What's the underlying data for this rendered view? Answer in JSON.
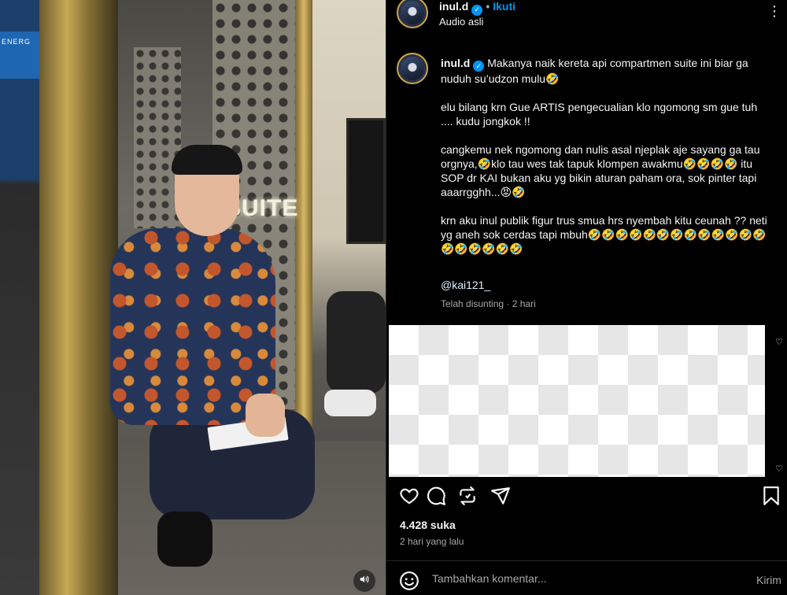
{
  "post": {
    "username": "inul.d",
    "separator": "•",
    "follow_label": "Ikuti",
    "audio_label": "Audio asli",
    "more_label": "⋮"
  },
  "caption": {
    "username": "inul.d",
    "paragraphs": [
      "Makanya naik kereta api compartmen suite ini biar ga nuduh su’udzon mulu🤣",
      "elu bilang krn Gue ARTIS pengecualian klo ngomong sm gue tuh .... kudu jongkok !!",
      "cangkemu nek ngomong dan nulis asal njeplak aje sayang ga tau orgnya,🤣klo tau wes tak tapuk klompen awakmu🤣🤣🤣🤣 itu SOP dr KAI bukan aku yg bikin aturan paham ora, sok pinter tapi aaarrgghh...😡🤣",
      "krn aku inul publik figur trus smua hrs nyembah kitu ceunah ?? neti yg aneh sok cerdas tapi mbuh🤣🤣🤣🤣🤣🤣🤣🤣🤣🤣🤣🤣🤣🤣🤣🤣🤣🤣🤣"
    ],
    "mention": "@kai121_",
    "meta": "Telah disunting · 2 hari"
  },
  "video": {
    "sign_text": "SUITE",
    "banner_text": "ENERG"
  },
  "stats": {
    "likes": "4.428 suka",
    "date": "2 hari yang lalu"
  },
  "comment": {
    "placeholder": "Tambahkan komentar...",
    "post_label": "Kirim"
  },
  "colors": {
    "accent": "#0095f6",
    "background": "#000000",
    "muted": "#a8a8a8"
  },
  "icons": [
    "heart-icon",
    "comment-icon",
    "repost-icon",
    "share-icon",
    "bookmark-icon",
    "emoji-icon",
    "speaker-icon",
    "verified-icon",
    "more-icon"
  ]
}
